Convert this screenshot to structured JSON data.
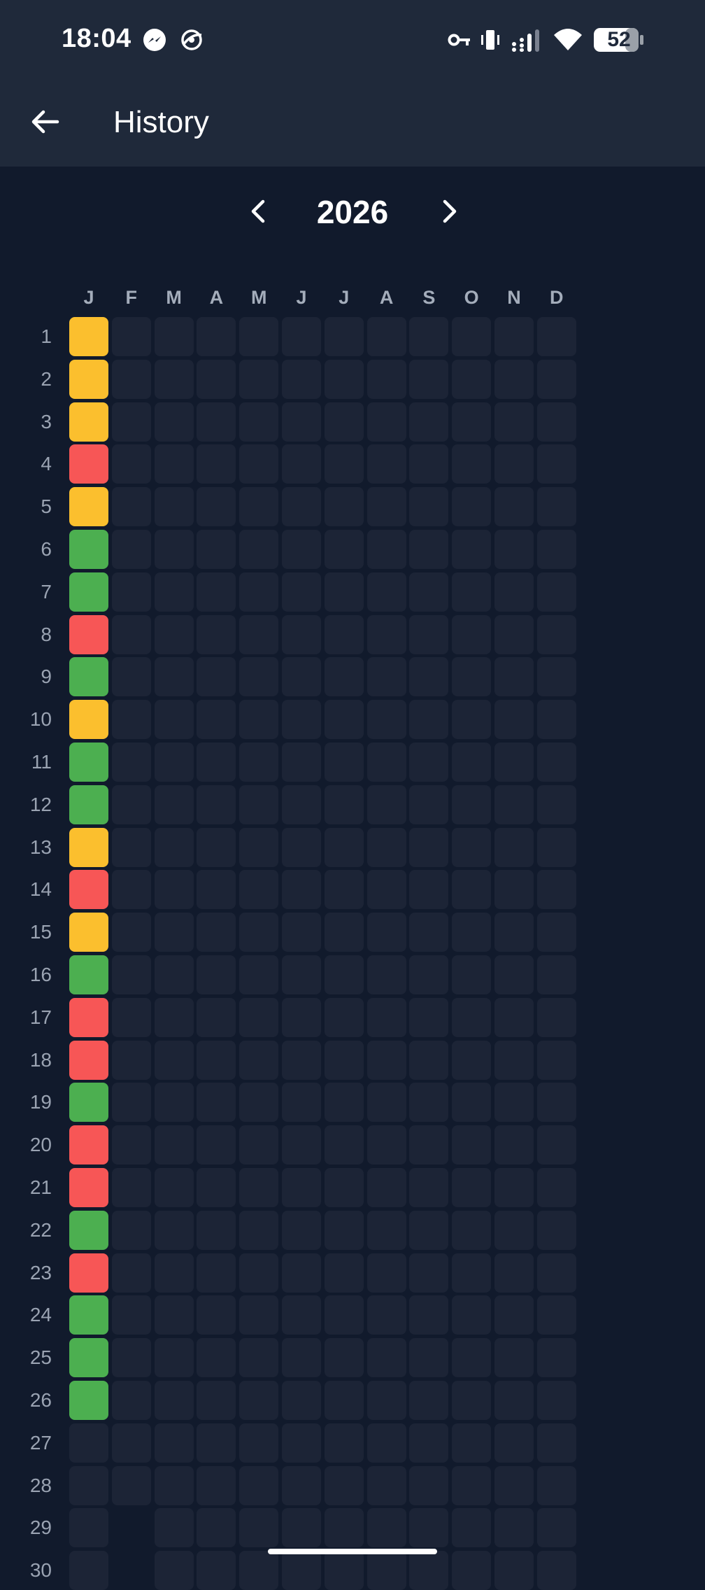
{
  "status_bar": {
    "time": "18:04",
    "battery": "52",
    "icons": [
      "messenger-icon",
      "vpn-globe-icon",
      "key-icon",
      "vibrate-icon",
      "signal-icon",
      "wifi-icon",
      "battery-icon"
    ]
  },
  "app_bar": {
    "title": "History",
    "back_icon": "back-arrow-icon"
  },
  "year_nav": {
    "year": "2026",
    "prev_icon": "chevron-left-icon",
    "next_icon": "chevron-right-icon"
  },
  "months": [
    "J",
    "F",
    "M",
    "A",
    "M",
    "J",
    "J",
    "A",
    "S",
    "O",
    "N",
    "D"
  ],
  "days": [
    "1",
    "2",
    "3",
    "4",
    "5",
    "6",
    "7",
    "8",
    "9",
    "10",
    "11",
    "12",
    "13",
    "14",
    "15",
    "16",
    "17",
    "18",
    "19",
    "20",
    "21",
    "22",
    "23",
    "24",
    "25",
    "26",
    "27",
    "28",
    "29",
    "30"
  ],
  "colors": {
    "good": "#4caf50",
    "medium": "#fbbf2e",
    "bad": "#f75656",
    "empty": "#1c2436"
  },
  "january_status": [
    "medium",
    "medium",
    "medium",
    "bad",
    "medium",
    "good",
    "good",
    "bad",
    "good",
    "medium",
    "good",
    "good",
    "medium",
    "bad",
    "medium",
    "good",
    "bad",
    "bad",
    "good",
    "bad",
    "bad",
    "good",
    "bad",
    "good",
    "good",
    "good"
  ]
}
